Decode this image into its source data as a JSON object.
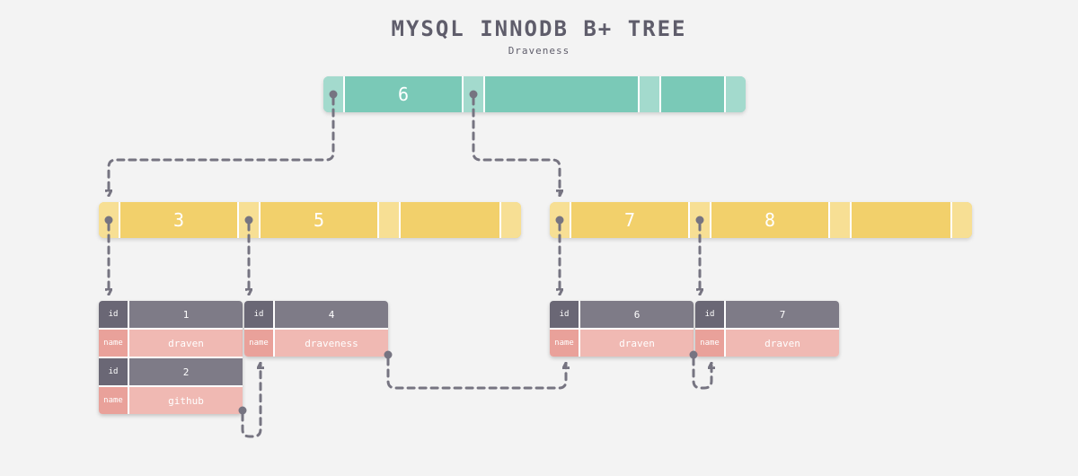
{
  "title": "MYSQL INNODB B+ TREE",
  "subtitle": "Draveness",
  "root": {
    "keys": [
      "6"
    ]
  },
  "internal": {
    "left": {
      "keys": [
        "3",
        "5"
      ]
    },
    "right": {
      "keys": [
        "7",
        "8"
      ]
    }
  },
  "records": {
    "leaf1a": {
      "id_label": "id",
      "id": "1",
      "name_label": "name",
      "name": "draven"
    },
    "leaf1b": {
      "id_label": "id",
      "id": "2",
      "name_label": "name",
      "name": "github"
    },
    "leaf2": {
      "id_label": "id",
      "id": "4",
      "name_label": "name",
      "name": "draveness"
    },
    "leaf3": {
      "id_label": "id",
      "id": "6",
      "name_label": "name",
      "name": "draven"
    },
    "leaf4": {
      "id_label": "id",
      "id": "7",
      "name_label": "name",
      "name": "draven"
    }
  }
}
